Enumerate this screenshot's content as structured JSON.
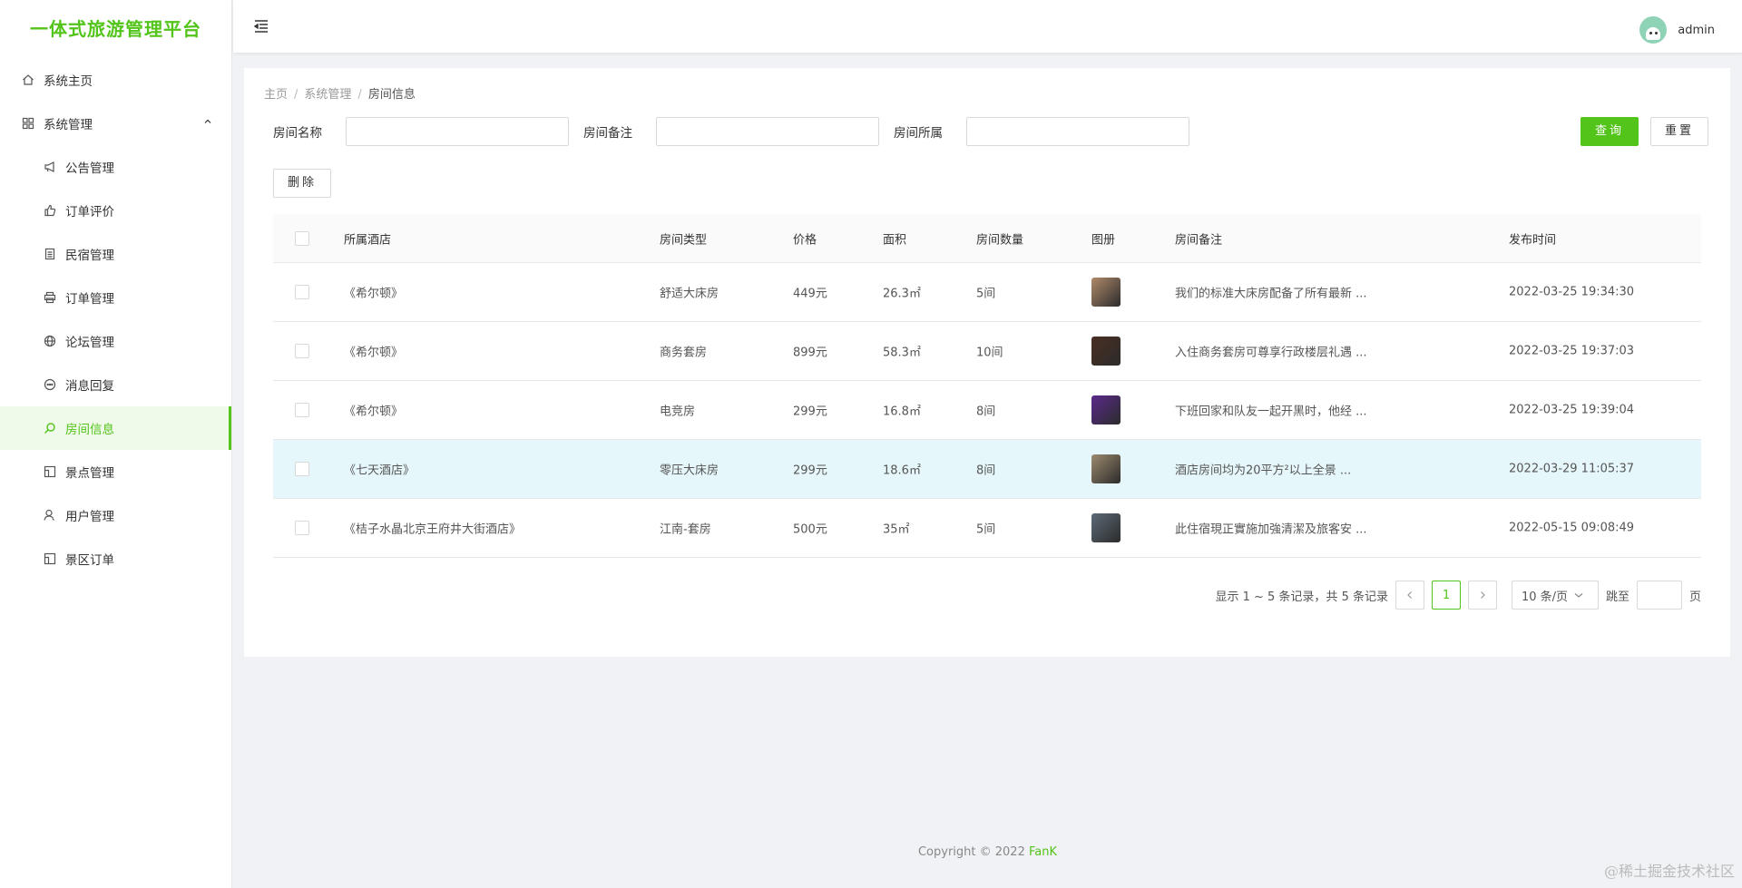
{
  "app": {
    "title": "一体式旅游管理平台"
  },
  "sidebar": {
    "items": [
      {
        "label": "系统主页",
        "icon": "home-icon"
      },
      {
        "label": "系统管理",
        "icon": "grid-icon"
      },
      {
        "label": "公告管理",
        "icon": "megaphone-icon"
      },
      {
        "label": "订单评价",
        "icon": "thumbs-up-icon"
      },
      {
        "label": "民宿管理",
        "icon": "list-icon"
      },
      {
        "label": "订单管理",
        "icon": "printer-icon"
      },
      {
        "label": "论坛管理",
        "icon": "globe-icon"
      },
      {
        "label": "消息回复",
        "icon": "chat-icon"
      },
      {
        "label": "房间信息",
        "icon": "search-icon"
      },
      {
        "label": "景点管理",
        "icon": "picture-icon"
      },
      {
        "label": "用户管理",
        "icon": "user-icon"
      },
      {
        "label": "景区订单",
        "icon": "picture-icon"
      }
    ]
  },
  "header": {
    "username": "admin"
  },
  "breadcrumb": {
    "home": "主页",
    "section": "系统管理",
    "current": "房间信息"
  },
  "search": {
    "name_label": "房间名称",
    "note_label": "房间备注",
    "hotel_label": "房间所属",
    "name_value": "",
    "note_value": "",
    "hotel_value": "",
    "query_label": "查询",
    "reset_label": "重置"
  },
  "toolbar": {
    "delete_label": "删除"
  },
  "table": {
    "headers": {
      "hotel": "所属酒店",
      "type": "房间类型",
      "price": "价格",
      "area": "面积",
      "count": "房间数量",
      "album": "图册",
      "note": "房间备注",
      "time": "发布时间"
    },
    "rows": [
      {
        "hotel": "《希尔顿》",
        "type": "舒适大床房",
        "price": "449元",
        "area": "26.3㎡",
        "count": "5间",
        "note": "我们的标准大床房配备了所有最新 ...",
        "time": "2022-03-25 19:34:30",
        "thumb_color": "#b08a6a"
      },
      {
        "hotel": "《希尔顿》",
        "type": "商务套房",
        "price": "899元",
        "area": "58.3㎡",
        "count": "10间",
        "note": "入住商务套房可尊享行政楼层礼遇 ...",
        "time": "2022-03-25 19:37:03",
        "thumb_color": "#4a2f22"
      },
      {
        "hotel": "《希尔顿》",
        "type": "电竞房",
        "price": "299元",
        "area": "16.8㎡",
        "count": "8间",
        "note": "下班回家和队友一起开黑时，他经 ...",
        "time": "2022-03-25 19:39:04",
        "thumb_color": "#5b2a8c"
      },
      {
        "hotel": "《七天酒店》",
        "type": "零压大床房",
        "price": "299元",
        "area": "18.6㎡",
        "count": "8间",
        "note": "酒店房间均为20平方²以上全景 ...",
        "time": "2022-03-29 11:05:37",
        "thumb_color": "#9c8a6e"
      },
      {
        "hotel": "《桔子水晶北京王府井大街酒店》",
        "type": "江南-套房",
        "price": "500元",
        "area": "35㎡",
        "count": "5间",
        "note": "此住宿現正實施加強清潔及旅客安 ...",
        "time": "2022-05-15 09:08:49",
        "thumb_color": "#5d6a78"
      }
    ]
  },
  "pagination": {
    "summary": "显示 1 ~ 5 条记录，共 5 条记录",
    "current_page": "1",
    "page_size": "10 条/页",
    "jump_label": "跳至",
    "page_suffix": "页"
  },
  "footer": {
    "copyright": "Copyright © 2022 ",
    "brand": "FanK"
  },
  "watermark": "@稀土掘金技术社区",
  "colors": {
    "accent": "#52c41a",
    "highlight_row": "#e6f7fc"
  }
}
